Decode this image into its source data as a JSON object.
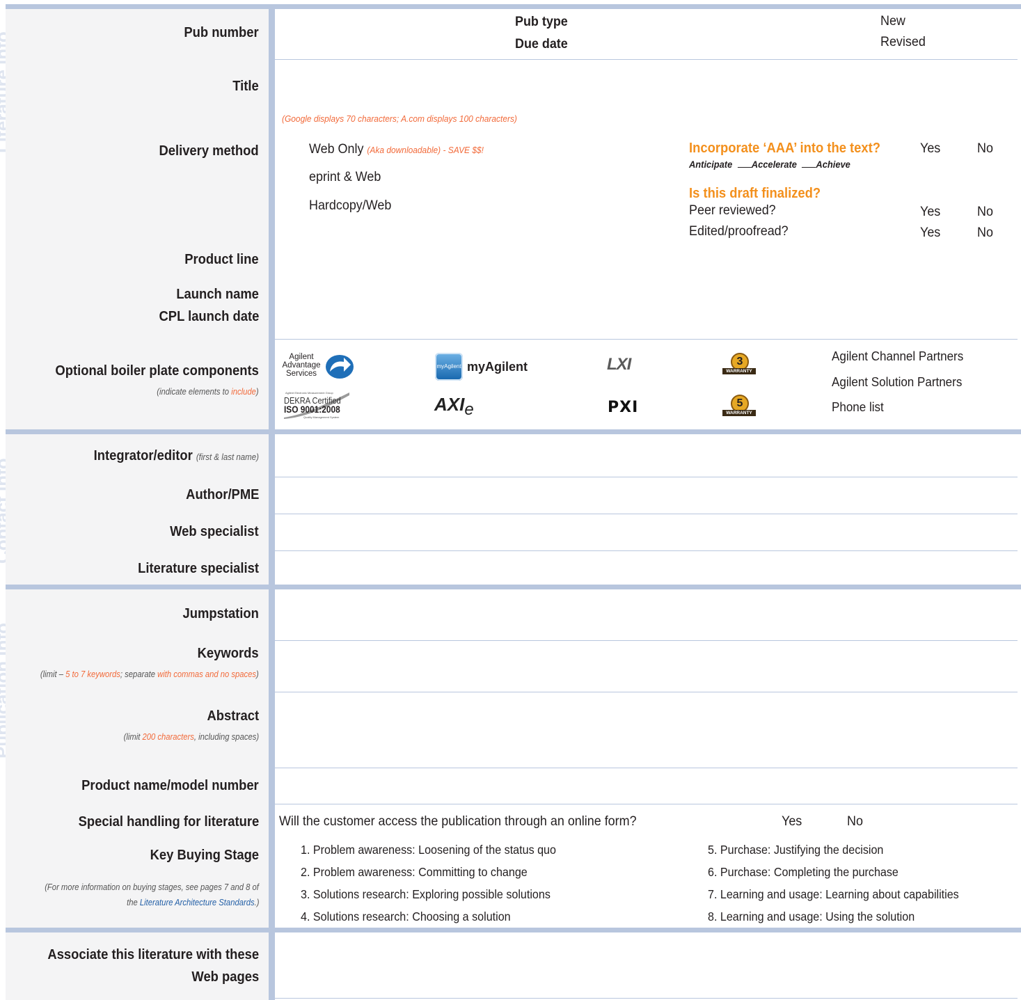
{
  "side_tabs": [
    "Literature info",
    "Contact info",
    "Publication info"
  ],
  "labels": {
    "pub_number": "Pub number",
    "pub_type": "Pub type",
    "due_date": "Due date",
    "pub_type_options": [
      "New",
      "Revised"
    ],
    "title": "Title",
    "title_note": "(Google displays 70 characters; A.com displays 100 characters)",
    "delivery_method": "Delivery method",
    "delivery_options": [
      "Web Only",
      "eprint & Web",
      "Hardcopy/Web"
    ],
    "web_only_note": "(Aka downloadable) - SAVE $$!",
    "aaa_question": "Incorporate ‘AAA’ into the text?",
    "aaa_words": [
      "Anticipate",
      "Accelerate",
      "Achieve"
    ],
    "draft_question": "Is this draft finalized?",
    "peer_reviewed": "Peer reviewed?",
    "edited": "Edited/proofread?",
    "yes": "Yes",
    "no": "No",
    "product_line": "Product line",
    "launch_name": "Launch name",
    "cpl_launch_date": "CPL launch date",
    "boiler_plate": "Optional boiler plate components",
    "boiler_note_a": "(indicate elements to ",
    "boiler_note_b": "include",
    "boiler_note_c": ")",
    "boiler_text_items": [
      "Agilent Channel Partners",
      "Agilent Solution Partners",
      "Phone list"
    ],
    "integrator": "Integrator/editor",
    "integrator_note": "(first & last name)",
    "author": "Author/PME",
    "web_specialist": "Web specialist",
    "lit_specialist": "Literature specialist",
    "jumpstation": "Jumpstation",
    "keywords": "Keywords",
    "keywords_note_a": "(limit – ",
    "keywords_note_b": "5 to 7 keywords",
    "keywords_note_c": "; separate ",
    "keywords_note_d": "with commas and no spaces",
    "keywords_note_e": ")",
    "abstract": "Abstract",
    "abstract_note_a": "(limit ",
    "abstract_note_b": "200 characters",
    "abstract_note_c": ", including spaces)",
    "product_name": "Product name/model number",
    "special_handling": "Special handling for literature",
    "online_form_question": "Will the customer access the publication through an online form?",
    "key_buying_stage": "Key Buying Stage",
    "kbs_note_line1": "(For more information on buying stages, see pages 7 and 8 of",
    "kbs_note_line2a": "the ",
    "kbs_note_line2b": "Literature Architecture Standards",
    "kbs_note_line2c": ".)",
    "buying_stages": [
      "1. Problem awareness: Loosening of the status quo",
      "2. Problem awareness: Committing to change",
      "3. Solutions research: Exploring possible solutions",
      "4. Solutions research:  Choosing a solution",
      "5. Purchase: Justifying the decision",
      "6. Purchase: Completing the purchase",
      "7. Learning and usage: Learning about capabilities",
      "8. Learning and usage: Using the solution"
    ],
    "associate_line1": "Associate this literature with these",
    "associate_line2": "Web pages"
  },
  "logos": {
    "advantage": [
      "Agilent",
      "Advantage",
      "Services"
    ],
    "myagilent_badge": "myAgilent",
    "myagilent": "myAgilent",
    "lxi": "LXI",
    "dekra_top": "Agilent Electronic Measurement Group",
    "dekra_mid": "DEKRA Certified",
    "dekra_iso": "ISO 9001:2008",
    "dekra_bottom": "Quality Management System",
    "axie": "AXI",
    "axie_sub": "e",
    "pxi": "PXI",
    "warranty3_num": "3",
    "warranty5_num": "5",
    "warranty_word": "WARRANTY"
  }
}
